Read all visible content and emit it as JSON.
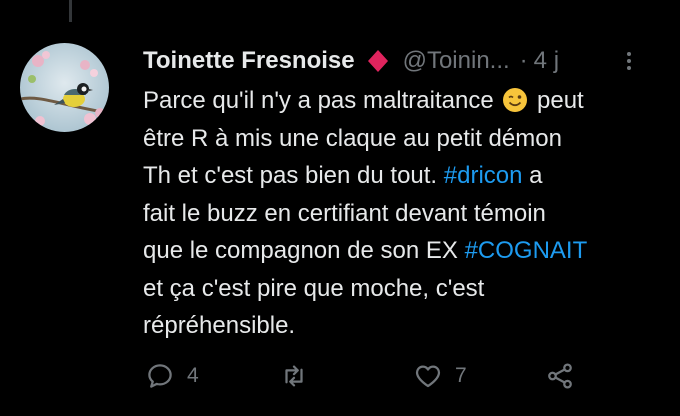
{
  "tweet": {
    "author_name": "Toinette Fresnoise",
    "badge_icon": "red-diamond-icon",
    "handle": "@Toinin...",
    "separator": "·",
    "time": "4 j",
    "text": {
      "line1_a": "Parce qu'il n'y a pas maltraitance",
      "emoji": "winking-face-emoji",
      "line1_b": "peut",
      "line2": "être R à mis une claque au petit démon",
      "line3_a": "Th et c'est pas bien du tout.",
      "hashtag1": "#dricon",
      "line3_b": "a",
      "line4": "fait le buzz en certifiant devant témoin",
      "line5_a": "que le compagnon de son EX",
      "hashtag2": "#COGNAIT",
      "line6": "et ça c'est pire que moche, c'est",
      "line7": "répréhensible."
    },
    "actions": {
      "reply_count": "4",
      "retweet_count": "",
      "like_count": "7"
    }
  },
  "colors": {
    "background": "#000000",
    "text": "#e7e9ea",
    "secondary": "#71767b",
    "hashtag": "#1d9bf0",
    "badge": "#e0245e"
  }
}
